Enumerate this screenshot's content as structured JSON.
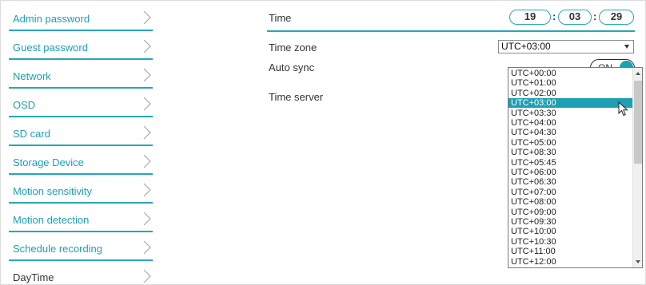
{
  "sidebar": {
    "items": [
      {
        "label": "Admin password",
        "active": true
      },
      {
        "label": "Guest password",
        "active": true
      },
      {
        "label": "Network",
        "active": true
      },
      {
        "label": "OSD",
        "active": true
      },
      {
        "label": "SD card",
        "active": true
      },
      {
        "label": "Storage Device",
        "active": true
      },
      {
        "label": "Motion sensitivity",
        "active": true
      },
      {
        "label": "Motion detection",
        "active": true
      },
      {
        "label": "Schedule recording",
        "active": true
      },
      {
        "label": "DayTime",
        "active": false
      }
    ]
  },
  "content": {
    "time_label": "Time",
    "time": {
      "hours": "19",
      "minutes": "03",
      "seconds": "29",
      "separator": ":"
    },
    "timezone_label": "Time zone",
    "timezone_value": "UTC+03:00",
    "autosync_label": "Auto sync",
    "autosync_state": "ON",
    "timeserver_label": "Time server"
  },
  "dropdown": {
    "options": [
      "UTC+00:00",
      "UTC+01:00",
      "UTC+02:00",
      "UTC+03:00",
      "UTC+03:30",
      "UTC+04:00",
      "UTC+04:30",
      "UTC+05:00",
      "UTC+08:30",
      "UTC+05:45",
      "UTC+06:00",
      "UTC+06:30",
      "UTC+07:00",
      "UTC+08:00",
      "UTC+09:00",
      "UTC+09:30",
      "UTC+10:00",
      "UTC+10:30",
      "UTC+11:00",
      "UTC+12:00"
    ],
    "selected": "UTC+03:00"
  },
  "colors": {
    "accent": "#1e9fb3",
    "text": "#333333",
    "border": "#27a6ba"
  },
  "icons": {
    "sidebar_chevron": "chevron-right-icon",
    "select_arrow": "triangle-down-icon",
    "pointer": "mouse-pointer-icon"
  }
}
